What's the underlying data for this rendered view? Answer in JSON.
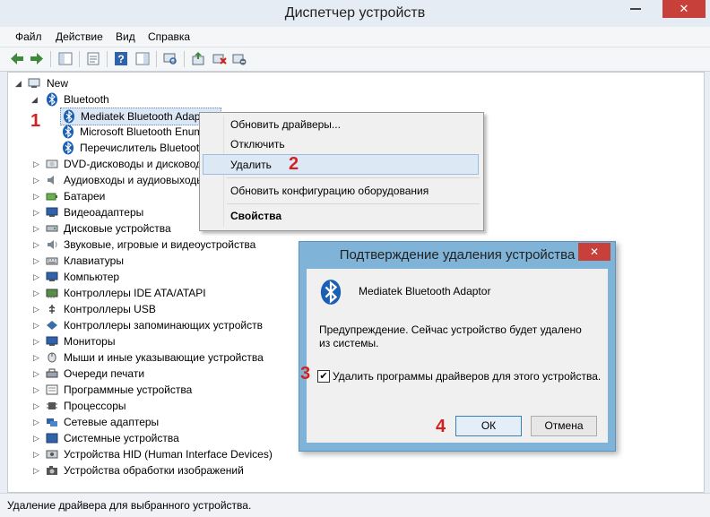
{
  "window": {
    "title": "Диспетчер устройств"
  },
  "menu": [
    "Файл",
    "Действие",
    "Вид",
    "Справка"
  ],
  "tree": {
    "root": "New",
    "bluetooth_group": "Bluetooth",
    "bluetooth_items": [
      "Mediatek Bluetooth Adapt",
      "Microsoft Bluetooth Enum",
      "Перечислитель Bluetoot"
    ],
    "categories": [
      "DVD-дисководы и дисковод",
      "Аудиовходы и аудиовыходы",
      "Батареи",
      "Видеоадаптеры",
      "Дисковые устройства",
      "Звуковые, игровые и видеоустройства",
      "Клавиатуры",
      "Компьютер",
      "Контроллеры IDE ATA/ATAPI",
      "Контроллеры USB",
      "Контроллеры запоминающих устройств",
      "Мониторы",
      "Мыши и иные указывающие устройства",
      "Очереди печати",
      "Программные устройства",
      "Процессоры",
      "Сетевые адаптеры",
      "Системные устройства",
      "Устройства HID (Human Interface Devices)",
      "Устройства обработки изображений"
    ]
  },
  "context_menu": {
    "items": [
      "Обновить драйверы...",
      "Отключить",
      "Удалить",
      "Обновить конфигурацию оборудования",
      "Свойства"
    ]
  },
  "dialog": {
    "title": "Подтверждение удаления устройства",
    "device_name": "Mediatek Bluetooth Adaptor",
    "warning": "Предупреждение. Сейчас устройство будет удалено из системы.",
    "checkbox_label": "Удалить программы драйверов для этого устройства.",
    "checkbox_checked": true,
    "ok_label": "ОК",
    "cancel_label": "Отмена"
  },
  "status": {
    "text": "Удаление драйвера для выбранного устройства."
  },
  "steps": [
    "1",
    "2",
    "3",
    "4"
  ],
  "colors": {
    "step_red": "#d42020",
    "bluetooth_blue": "#1a5fb4",
    "close_red": "#c7403a",
    "dialog_frame": "#7fb4d8"
  }
}
